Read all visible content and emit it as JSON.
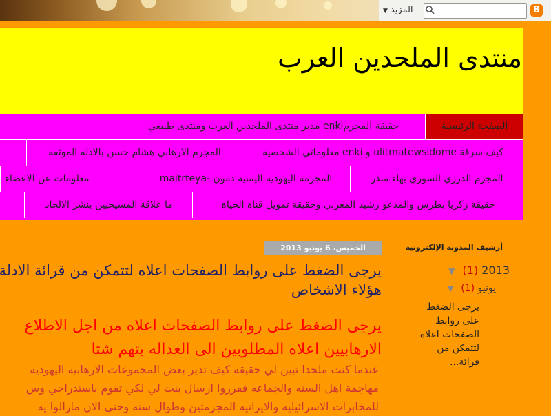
{
  "navbar": {
    "more_label": "المزيد",
    "search_placeholder": ""
  },
  "header": {
    "title": "منتدى الملحدين العرب"
  },
  "pages": {
    "tabs": [
      {
        "label": "الصفحة الرئيسية",
        "active": true
      },
      {
        "label": "حقيقة المجرمenki مدير منتدى الملحدين العرب ومنتدى طبيعي"
      },
      {
        "label": "كيف سرقة ulitmatewsidome و enki معلوماتي الشخصيه"
      },
      {
        "label": "المجرم الارهابي هشام حسن بالادله الموثقه"
      },
      {
        "label": "المجرم الدرزي السوري بهاء منذر"
      },
      {
        "label": "المجرمه اليهوديه اليمنيه دمون -maitrteya"
      },
      {
        "label": "معلومات عن الاعضاء الملحدين"
      },
      {
        "label": "حقيقة زكريا بطرس والمدعو رشيد المغربي وحقيقة تمويل قناة الحياة"
      },
      {
        "label": "ما علاقة المسيحيين بنشر الالحاد"
      }
    ]
  },
  "sidebar": {
    "archive_title": "أرشيف المدونة الإلكترونية",
    "year": "2013",
    "year_count": "(1)",
    "month": "يونيو",
    "month_count": "(1)",
    "post_link": "يرجى الضغط على روابط الصفحات اعلاه لتتمكن من قرائة..."
  },
  "post": {
    "date": "الخميس، 6 يونيو 2013",
    "title_line1": "يرجى الضغط على روابط الصفحات اعلاه لتتمكن من قرائة الادلة",
    "title_line2": "هؤلاء الاشخاص",
    "heading_line1": "يرجى الضغط على روابط الصفحات اعلاه من اجل الاطلاع",
    "heading_line2": "الارهابيين اعلاه المطلوبين الى العداله بتهم شتا",
    "body_line1": "عندما كنت ملحدا تبين لي حقيقة كيف تدير بعض المجموعات الارهابيه اليهودية",
    "body_line2": "مهاجمة اهل السنه والجماعه فقرروا ارسال بنت لي لكي تقوم باستدراجي وس",
    "body_line3": "للمخابرات الاسرائيليه والايرانيه المجرمتين وطوال سنه وحتى الان مازالوا يه"
  },
  "colors": {
    "page_bg": "#ff9900",
    "header_bg": "#ffff00",
    "tabs_bg": "#ff00ff",
    "active_tab": "#cc0000"
  }
}
